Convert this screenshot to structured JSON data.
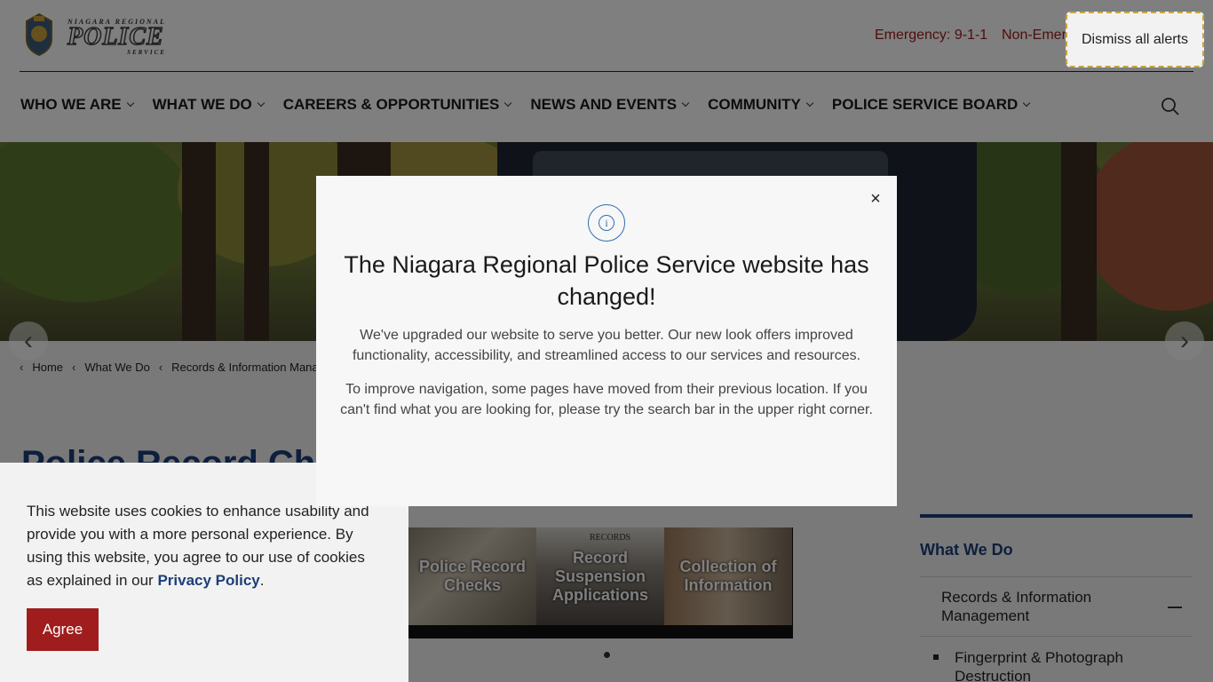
{
  "header": {
    "logo": {
      "top": "NIAGARA REGIONAL",
      "main": "POLICE",
      "bottom": "SERVICE"
    },
    "emergency": "Emergency: 9-1-1",
    "non_emergency": "Non-Emerg"
  },
  "nav": {
    "items": [
      {
        "label": "WHO WE ARE"
      },
      {
        "label": "WHAT WE DO"
      },
      {
        "label": "CAREERS & OPPORTUNITIES"
      },
      {
        "label": "NEWS AND EVENTS"
      },
      {
        "label": "COMMUNITY"
      },
      {
        "label": "POLICE SERVICE BOARD"
      }
    ],
    "search_icon": "search-icon"
  },
  "breadcrumb": [
    "Home",
    "What We Do",
    "Records & Information Manage..."
  ],
  "page_title": "Police Record Checks",
  "tiles": [
    {
      "label": "Police Record Checks"
    },
    {
      "label": "Record Suspension Applications"
    },
    {
      "label": "Collection of Information"
    }
  ],
  "tile_photo_sign": "RECORDS",
  "sidebar": {
    "title": "What We Do",
    "item": "Records & Information Management",
    "sub_item": "Fingerprint & Photograph Destruction"
  },
  "cookie": {
    "text": "This website uses cookies to enhance usability and provide you with a more personal experience. By using this website, you agree to our use of cookies as explained in our ",
    "link": "Privacy Policy",
    "after": ".",
    "agree_label": "Agree"
  },
  "dismiss_label": "Dismiss all alerts",
  "modal": {
    "title": "The Niagara Regional Police Service website has changed!",
    "para1": "We've upgraded our website to serve you better. Our new look offers improved functionality, accessibility, and streamlined access to our services and resources.",
    "para2": "To improve navigation, some pages have moved from their previous location. If you can't find what you are looking for, please try the search bar in the upper right corner.",
    "close": "×",
    "info_glyph": "i"
  },
  "colors": {
    "brand_blue": "#1c3f7a",
    "brand_red": "#a01d1d",
    "info_blue": "#2f6fb5"
  }
}
